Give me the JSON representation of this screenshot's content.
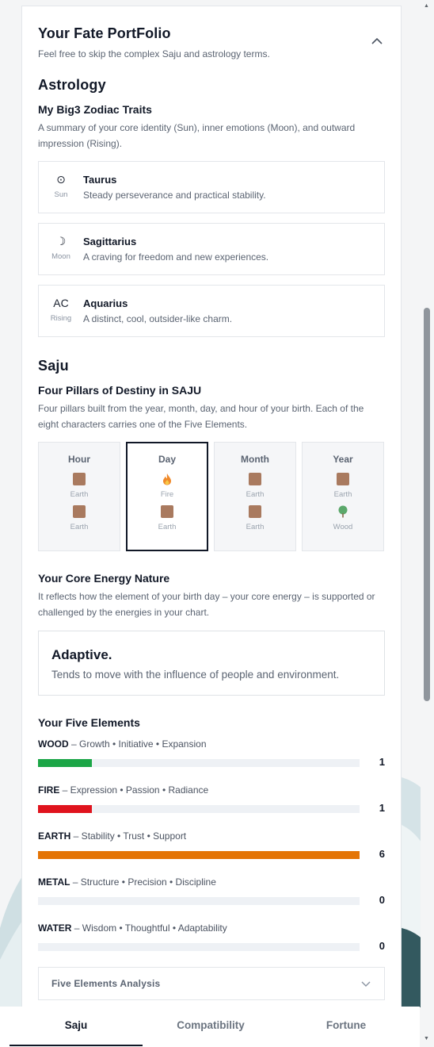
{
  "header": {
    "title": "Your Fate PortFolio",
    "subtitle": "Feel free to skip the complex Saju and astrology terms."
  },
  "astrology": {
    "section": "Astrology",
    "title": "My Big3 Zodiac Traits",
    "desc": "A summary of your core identity (Sun), inner emotions (Moon), and outward impression (Rising).",
    "items": [
      {
        "icon": "⊙",
        "label": "Sun",
        "sign": "Taurus",
        "desc": "Steady perseverance and practical stability."
      },
      {
        "icon": "☽",
        "label": "Moon",
        "sign": "Sagittarius",
        "desc": "A craving for freedom and new experiences."
      },
      {
        "icon": "AC",
        "label": "Rising",
        "sign": "Aquarius",
        "desc": "A distinct, cool, outsider-like charm."
      }
    ]
  },
  "saju": {
    "section": "Saju",
    "title": "Four Pillars of Destiny in SAJU",
    "desc": "Four pillars built from the year, month, day, and hour of your birth. Each of the eight characters carries one of the Five Elements.",
    "pillars": [
      {
        "name": "Hour",
        "top": "Earth",
        "bottom": "Earth",
        "active": false
      },
      {
        "name": "Day",
        "top": "Fire",
        "bottom": "Earth",
        "active": true
      },
      {
        "name": "Month",
        "top": "Earth",
        "bottom": "Earth",
        "active": false
      },
      {
        "name": "Year",
        "top": "Earth",
        "bottom": "Wood",
        "active": false
      }
    ]
  },
  "core_energy": {
    "title": "Your Core Energy Nature",
    "desc": "It reflects how the element of your birth day – your core energy – is supported or challenged by the energies in your chart.",
    "result": "Adaptive.",
    "result_desc": "Tends to move with the influence of people and environment."
  },
  "five_elements": {
    "title": "Your Five Elements",
    "max": 6,
    "items": [
      {
        "name": "WOOD",
        "traits": " – Growth • Initiative • Expansion",
        "count": 1,
        "color": "#1ca647"
      },
      {
        "name": "FIRE",
        "traits": " – Expression • Passion • Radiance",
        "count": 1,
        "color": "#e0131d"
      },
      {
        "name": "EARTH",
        "traits": " – Stability • Trust • Support",
        "count": 6,
        "color": "#e47405"
      },
      {
        "name": "METAL",
        "traits": " – Structure • Precision • Discipline",
        "count": 0,
        "color": "#9aa3ae"
      },
      {
        "name": "WATER",
        "traits": " – Wisdom • Thoughtful • Adaptability",
        "count": 0,
        "color": "#3b82f6"
      }
    ],
    "analysis_label": "Five Elements Analysis"
  },
  "tabs": {
    "saju": "Saju",
    "compat": "Compatibility",
    "fortune": "Fortune"
  }
}
